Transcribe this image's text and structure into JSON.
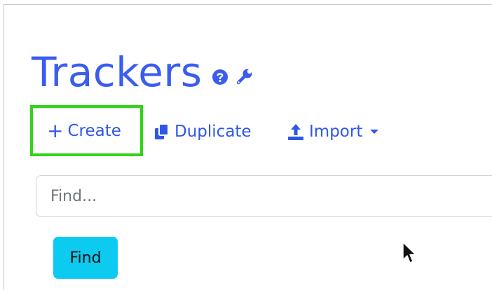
{
  "page": {
    "title": "Trackers"
  },
  "icons": {
    "help": "question-circle-icon",
    "settings": "wrench-icon",
    "create": "plus-icon",
    "duplicate": "copy-icon",
    "import": "upload-icon",
    "import_menu": "caret-down-icon",
    "pointer": "mouse-cursor-icon"
  },
  "toolbar": {
    "create_plus": "+",
    "create_label": "Create",
    "duplicate_label": "Duplicate",
    "import_label": "Import"
  },
  "search": {
    "placeholder": "Find...",
    "value": "",
    "button_label": "Find"
  },
  "colors": {
    "title": "#3a5cf0",
    "link": "#2f56e8",
    "highlight_border": "#32d417",
    "find_button": "#0dcaf0"
  }
}
